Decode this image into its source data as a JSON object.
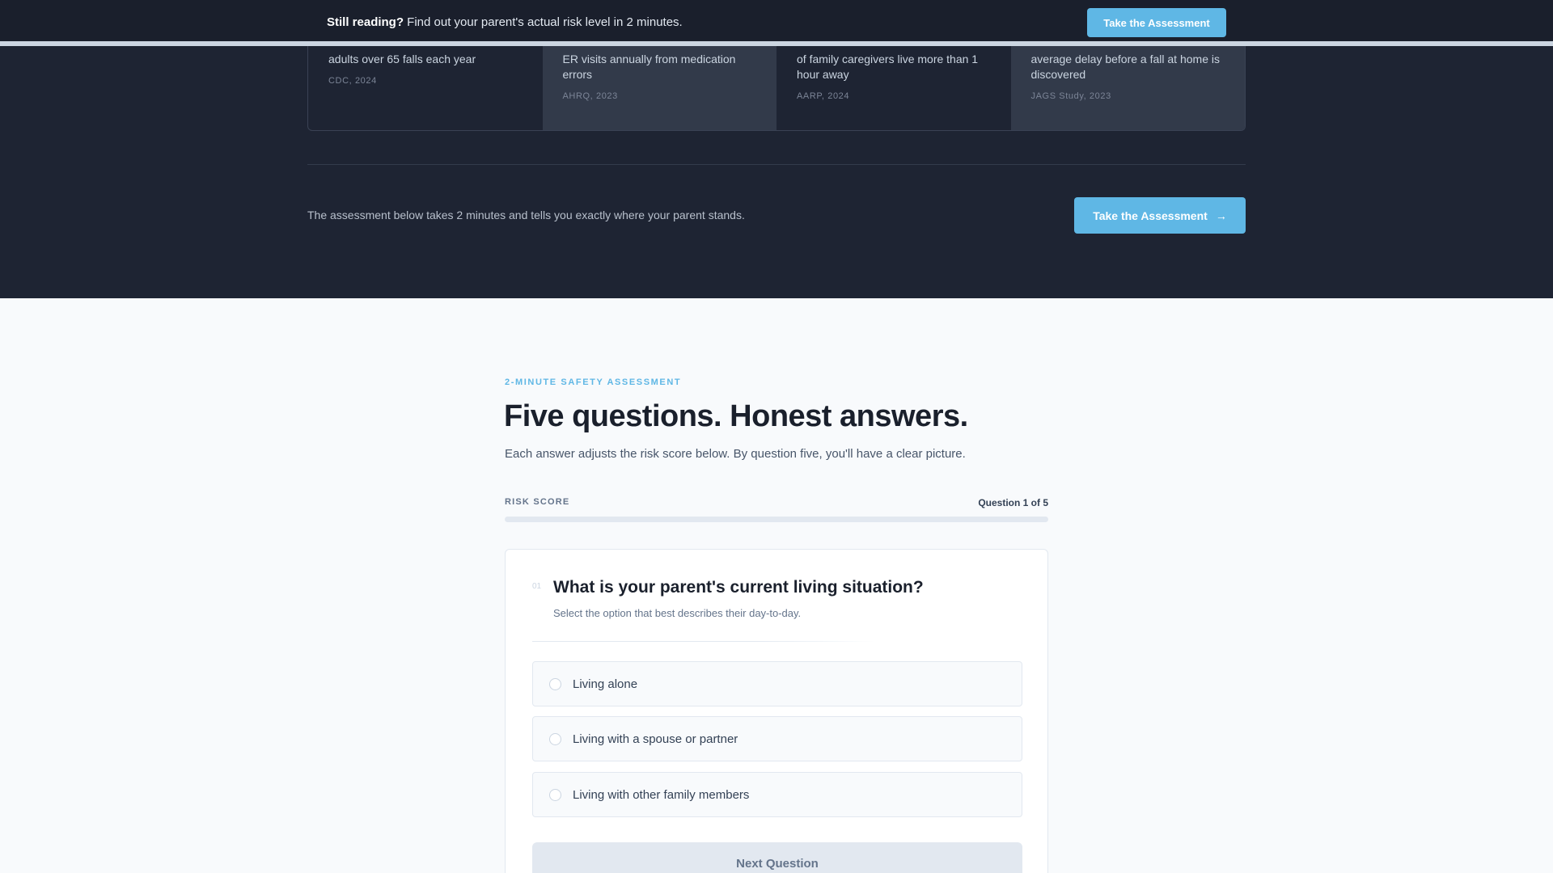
{
  "sticky_banner": {
    "lead": "Still reading?",
    "text": " Find out your parent's actual risk level in 2 minutes.",
    "button_label": "Take the Assessment"
  },
  "stats": [
    {
      "description": "adults over 65 falls each year",
      "source": "CDC, 2024"
    },
    {
      "description": "ER visits annually from medication errors",
      "source": "AHRQ, 2023"
    },
    {
      "description": "of family caregivers live more than 1 hour away",
      "source": "AARP, 2024"
    },
    {
      "description": "average delay before a fall at home is discovered",
      "source": "JAGS Study, 2023"
    }
  ],
  "cta": {
    "text": "The assessment below takes 2 minutes and tells you exactly where your parent stands.",
    "button_label": "Take the Assessment",
    "button_icon": "arrow-right-icon"
  },
  "assessment": {
    "eyebrow": "2-MINUTE SAFETY ASSESSMENT",
    "title": "Five questions. Honest answers.",
    "subtitle": "Each answer adjusts the risk score below. By question five, you'll have a clear picture.",
    "score_label": "RISK SCORE",
    "counter": "Question 1 of 5",
    "progress_percent": 0
  },
  "question": {
    "number": "01",
    "title": "What is your parent's current living situation?",
    "hint": "Select the option that best describes their day-to-day.",
    "options": [
      {
        "label": "Living alone"
      },
      {
        "label": "Living with a spouse or partner"
      },
      {
        "label": "Living with other family members"
      }
    ],
    "next_label": "Next Question"
  },
  "colors": {
    "accent": "#5fb7e5",
    "dark_bg": "#1e2433",
    "light_bg": "#f8fafc"
  }
}
